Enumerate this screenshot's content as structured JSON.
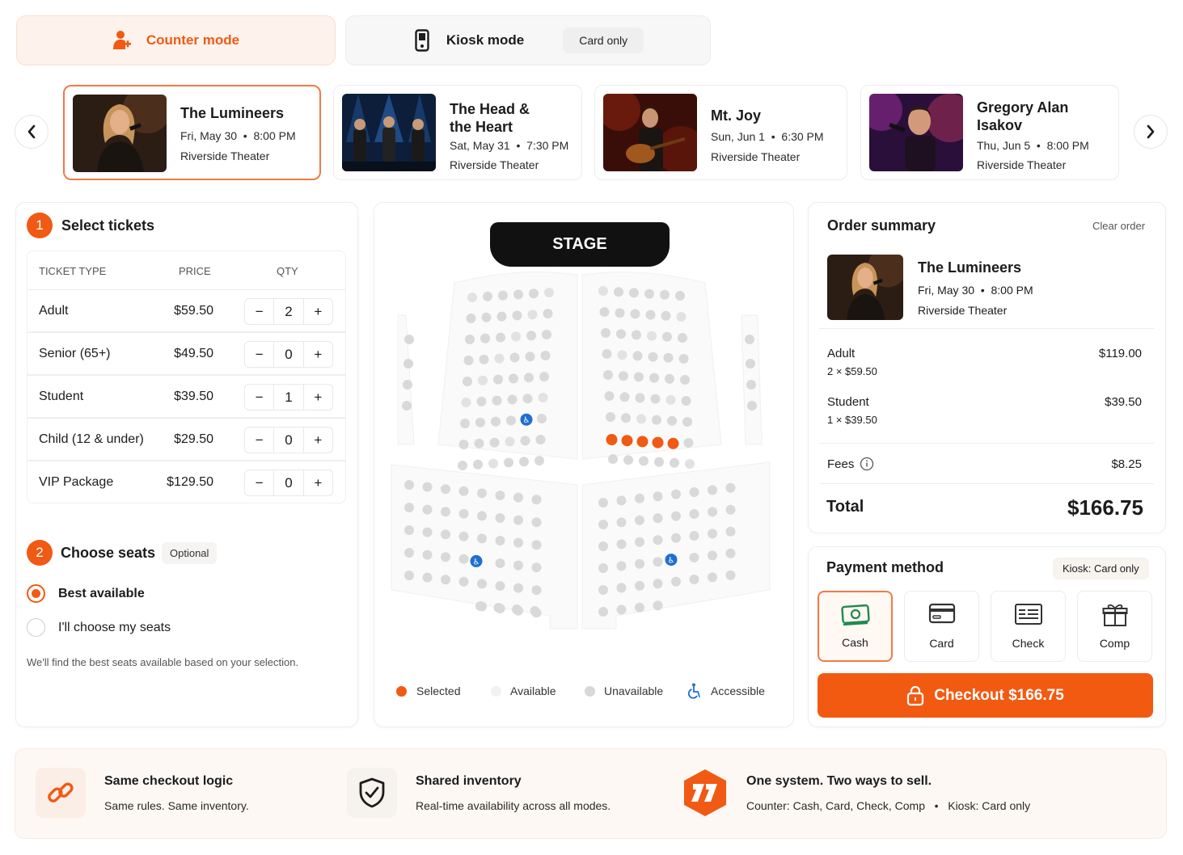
{
  "modes": {
    "counter_label": "Counter mode",
    "kiosk_label": "Kiosk mode",
    "kiosk_badge": "Card only"
  },
  "events": [
    {
      "title_1": "The Lumineers",
      "title_2": "",
      "date": "Fri, May 30",
      "time": "8:00 PM",
      "venue": "Riverside Theater",
      "selected": true
    },
    {
      "title_1": "The Head &",
      "title_2": "the Heart",
      "date": "Sat, May 31",
      "time": "7:30 PM",
      "venue": "Riverside Theater",
      "selected": false
    },
    {
      "title_1": "Mt. Joy",
      "title_2": "",
      "date": "Sun, Jun 1",
      "time": "6:30 PM",
      "venue": "Riverside Theater",
      "selected": false
    },
    {
      "title_1": "Gregory Alan",
      "title_2": "Isakov",
      "date": "Thu, Jun 5",
      "time": "8:00 PM",
      "venue": "Riverside Theater",
      "selected": false
    }
  ],
  "tickets": {
    "step": "1",
    "heading": "Select tickets",
    "col_type": "TICKET TYPE",
    "col_price": "PRICE",
    "col_qty": "QTY",
    "rows": [
      {
        "name": "Adult",
        "price": "$59.50",
        "qty": "2"
      },
      {
        "name": "Senior (65+)",
        "price": "$49.50",
        "qty": "0"
      },
      {
        "name": "Student",
        "price": "$39.50",
        "qty": "1"
      },
      {
        "name": "Child (12 & under)",
        "price": "$29.50",
        "qty": "0"
      },
      {
        "name": "VIP Package",
        "price": "$129.50",
        "qty": "0"
      }
    ],
    "minus": "−",
    "plus": "+"
  },
  "seats": {
    "step": "2",
    "heading": "Choose seats",
    "optional": "Optional",
    "option_best": "Best available",
    "option_choose": "I'll choose my seats",
    "selected_option": "best",
    "hint": "We'll find the best seats available based on your selection."
  },
  "seatmap": {
    "stage": "STAGE",
    "legend_selected": "Selected",
    "legend_available": "Available",
    "legend_unavailable": "Unavailable",
    "legend_accessible": "Accessible",
    "selected_count": 5
  },
  "order": {
    "heading": "Order summary",
    "clear": "Clear order",
    "event_title": "The Lumineers",
    "event_date": "Fri, May 30",
    "event_time": "8:00 PM",
    "event_venue": "Riverside Theater",
    "lines": [
      {
        "label": "Adult",
        "detail": "2 × $59.50",
        "amount": "$119.00"
      },
      {
        "label": "Student",
        "detail": "1 × $39.50",
        "amount": "$39.50"
      }
    ],
    "fees_label": "Fees",
    "fees_amount": "$8.25",
    "total_label": "Total",
    "total_amount": "$166.75"
  },
  "payment": {
    "heading": "Payment method",
    "badge": "Kiosk: Card only",
    "options": [
      {
        "label": "Cash",
        "icon": "cash-icon",
        "selected": true
      },
      {
        "label": "Card",
        "icon": "card-icon",
        "selected": false
      },
      {
        "label": "Check",
        "icon": "check-icon",
        "selected": false
      },
      {
        "label": "Comp",
        "icon": "gift-icon",
        "selected": false
      }
    ],
    "checkout_label": "Checkout $166.75"
  },
  "footer": {
    "items": [
      {
        "title": "Same checkout logic",
        "sub": "Same rules. Same inventory.",
        "icon": "link-icon"
      },
      {
        "title": "Shared inventory",
        "sub": "Real-time availability across all modes.",
        "icon": "shield-check-icon"
      },
      {
        "title": "One system. Two ways to sell.",
        "sub_a": "Counter: Cash, Card, Check, Comp",
        "sub_b": "Kiosk: Card only",
        "icon": "logo-icon"
      }
    ]
  },
  "colors": {
    "accent": "#f05a14",
    "accessible": "#1f6fd1",
    "available": "#d9d9d9",
    "unavailable": "#ececec"
  }
}
